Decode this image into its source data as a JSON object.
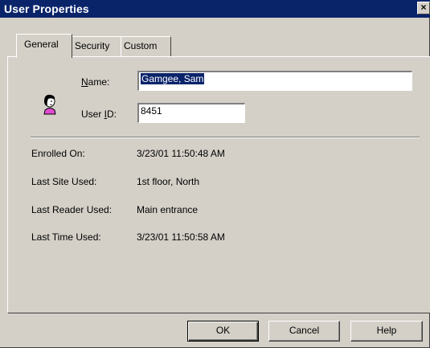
{
  "window": {
    "title": "User Properties",
    "close_glyph": "×"
  },
  "tabs": [
    {
      "label": "General",
      "active": true
    },
    {
      "label": "Security",
      "active": false
    },
    {
      "label": "Custom",
      "active": false
    }
  ],
  "general": {
    "name_label_accel": "N",
    "name_label_rest": "ame:",
    "name_value": "Gamgee, Sam",
    "userid_label_pre": "User ",
    "userid_label_accel": "I",
    "userid_label_rest": "D:",
    "userid_value": "8451",
    "info": [
      {
        "label": "Enrolled On:",
        "value": "3/23/01 11:50:48 AM"
      },
      {
        "label": "Last Site Used:",
        "value": "1st floor, North"
      },
      {
        "label": "Last Reader Used:",
        "value": "Main entrance"
      },
      {
        "label": "Last Time Used:",
        "value": "3/23/01 11:50:58 AM"
      }
    ]
  },
  "buttons": {
    "ok": "OK",
    "cancel": "Cancel",
    "help": "Help"
  },
  "icons": {
    "user": "user-icon"
  },
  "colors": {
    "titlebar": "#0a246a",
    "face": "#d4d0c8",
    "selection": "#0a246a"
  }
}
